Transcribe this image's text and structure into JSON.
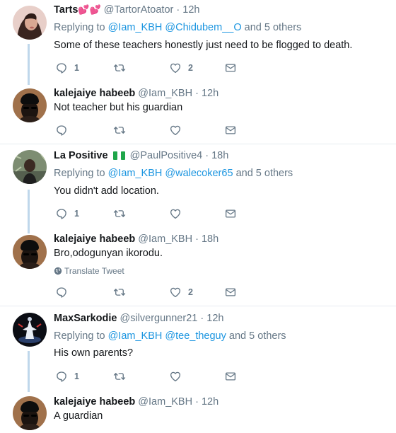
{
  "tweets": [
    {
      "name": "Tarts",
      "name_emoji": "💕💕",
      "handle": "@TartorAtoator",
      "time": "12h",
      "reply_prefix": "Replying to",
      "reply_1": "@Iam_KBH",
      "reply_2": "@Chidubem__O",
      "reply_rest": "and 5 others",
      "text": "Some of these teachers honestly just need to be flogged to death.",
      "reply_count": "1",
      "retweet_count": "",
      "like_count": "2"
    },
    {
      "name": "kalejaiye habeeb",
      "handle": "@Iam_KBH",
      "time": "12h",
      "text": "Not teacher but his guardian",
      "reply_count": "",
      "retweet_count": "",
      "like_count": ""
    },
    {
      "name": "La Positive",
      "flag": "nigeria-flag",
      "handle": "@PaulPositive4",
      "time": "18h",
      "reply_prefix": "Replying to",
      "reply_1": "@Iam_KBH",
      "reply_2": "@walecoker65",
      "reply_rest": "and 5 others",
      "text": "You didn't add location.",
      "reply_count": "1",
      "retweet_count": "",
      "like_count": ""
    },
    {
      "name": "kalejaiye habeeb",
      "handle": "@Iam_KBH",
      "time": "18h",
      "text": "Bro,odogunyan ikorodu.",
      "translate": "Translate Tweet",
      "reply_count": "",
      "retweet_count": "",
      "like_count": "2"
    },
    {
      "name": "MaxSarkodie",
      "handle": "@silvergunner21",
      "time": "12h",
      "reply_prefix": "Replying to",
      "reply_1": "@Iam_KBH",
      "reply_2": "@tee_theguy",
      "reply_rest": "and 5 others",
      "text": "His own parents?",
      "reply_count": "1",
      "retweet_count": "",
      "like_count": ""
    },
    {
      "name": "kalejaiye habeeb",
      "handle": "@Iam_KBH",
      "time": "12h",
      "text": "A guardian"
    }
  ],
  "separator": "·",
  "colors": {
    "link": "#1b95e0",
    "muted": "#657786",
    "thread_line": "#bfd7eb",
    "divider": "#e6ecf0"
  }
}
